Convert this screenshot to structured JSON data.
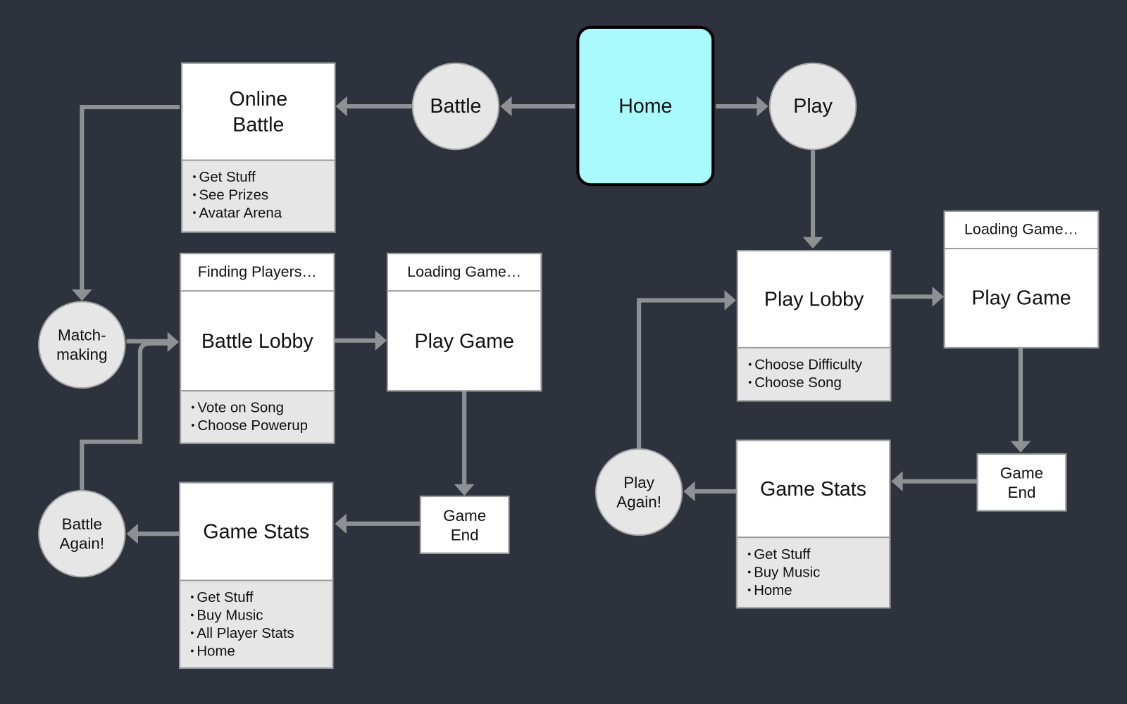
{
  "colors": {
    "background": "#2e323d",
    "home_fill": "#a8fafc",
    "connector": "#8e9194",
    "list_fill": "#e6e6e6"
  },
  "nodes": {
    "home": "Home",
    "battle": "Battle",
    "play": "Play",
    "online_battle": {
      "title_line1": "Online",
      "title_line2": "Battle",
      "items": [
        "Get Stuff",
        "See Prizes",
        "Avatar Arena"
      ]
    },
    "matchmaking": {
      "line1": "Match-",
      "line2": "making"
    },
    "battle_lobby": {
      "header": "Finding Players…",
      "title": "Battle Lobby",
      "items": [
        "Vote on Song",
        "Choose Powerup"
      ]
    },
    "battle_play_game": {
      "header": "Loading Game…",
      "title": "Play Game"
    },
    "battle_game_end": {
      "line1": "Game",
      "line2": "End"
    },
    "battle_game_stats": {
      "title": "Game Stats",
      "items": [
        "Get Stuff",
        "Buy Music",
        "All Player Stats",
        "Home"
      ]
    },
    "battle_again": {
      "line1": "Battle",
      "line2": "Again!"
    },
    "play_lobby": {
      "title": "Play Lobby",
      "items": [
        "Choose Difficulty",
        "Choose Song"
      ]
    },
    "play_play_game": {
      "header": "Loading Game…",
      "title": "Play Game"
    },
    "play_game_end": {
      "line1": "Game",
      "line2": "End"
    },
    "play_game_stats": {
      "title": "Game Stats",
      "items": [
        "Get Stuff",
        "Buy Music",
        "Home"
      ]
    },
    "play_again": {
      "line1": "Play",
      "line2": "Again!"
    }
  }
}
